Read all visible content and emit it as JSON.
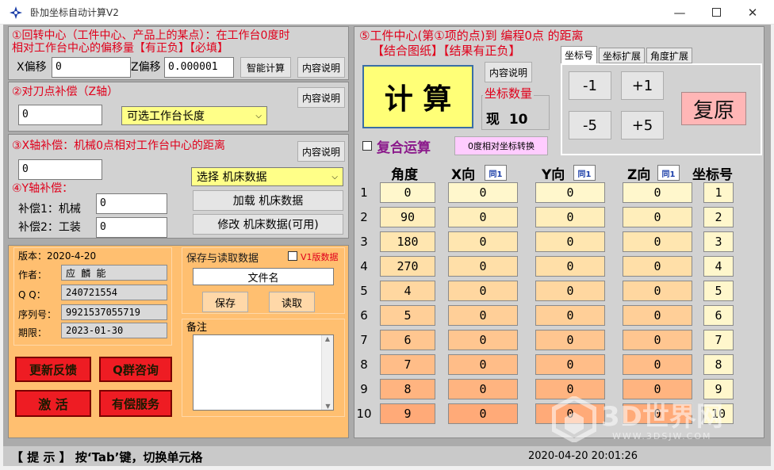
{
  "window": {
    "title": "卧加坐标自动计算V2"
  },
  "panel1": {
    "title_line1": "①回转中心（工件中心、产品上的某点）：在工作台0度时",
    "title_line2": "相对工作台中心的偏移量【有正负】【必填】",
    "x_label": "X偏移",
    "x_value": "0",
    "z_label": "Z偏移",
    "z_value": "0.000001",
    "smart_calc": "智能计算",
    "info": "内容说明"
  },
  "panel2": {
    "title": "②对刀点补偿（Z轴）",
    "value": "0",
    "combo": "可选工作台长度",
    "info": "内容说明"
  },
  "panel3": {
    "title": "③X轴补偿：机械0点相对工作台中心的距离",
    "value": "0",
    "info": "内容说明",
    "combo": "选择 机床数据",
    "y_title": "④Y轴补偿：",
    "comp1_label": "补偿1：机械",
    "comp1_value": "0",
    "comp2_label": "补偿2：工装",
    "comp2_value": "0",
    "load": "加载 机床数据",
    "modify": "修改 机床数据(可用)"
  },
  "info_panel": {
    "version": "版本：2020-4-20",
    "author_label": "作者：",
    "author": "应 麟 能",
    "qq_label": "Q Q：",
    "qq": "240721554",
    "serial_label": "序列号：",
    "serial": "9921537055719",
    "expiry_label": "期限：",
    "expiry": "2023-01-30",
    "update": "更新反馈",
    "qgroup": "Q群咨询",
    "activate": "激 活",
    "paid": "有偿服务",
    "save_title": "保存与读取数据",
    "v1_label": "V1版数据",
    "filename": "文件名",
    "save": "保存",
    "read": "读取",
    "remarks": "备注"
  },
  "panel5": {
    "title": "⑤工件中心(第①项的点)到 编程0点 的距离",
    "subtitle": "【结合图纸】【结果有正负】",
    "calc": "计 算",
    "info": "内容说明",
    "count_label": "坐标数量",
    "count_value": "现  10",
    "composite": "复合运算",
    "convert": "0度相对坐标转换",
    "tabs": [
      "坐标号",
      "坐标扩展",
      "角度扩展"
    ],
    "steps": [
      "-1",
      "+1",
      "-5",
      "+5"
    ],
    "reset": "复原",
    "headers": {
      "angle": "角度",
      "x": "X向",
      "y": "Y向",
      "z": "Z向",
      "coord": "坐标号",
      "tag": "同1"
    },
    "rows": [
      {
        "n": "1",
        "a": "0",
        "x": "0",
        "y": "0",
        "z": "0",
        "c": "1"
      },
      {
        "n": "2",
        "a": "90",
        "x": "0",
        "y": "0",
        "z": "0",
        "c": "2"
      },
      {
        "n": "3",
        "a": "180",
        "x": "0",
        "y": "0",
        "z": "0",
        "c": "3"
      },
      {
        "n": "4",
        "a": "270",
        "x": "0",
        "y": "0",
        "z": "0",
        "c": "4"
      },
      {
        "n": "5",
        "a": "4",
        "x": "0",
        "y": "0",
        "z": "0",
        "c": "5"
      },
      {
        "n": "6",
        "a": "5",
        "x": "0",
        "y": "0",
        "z": "0",
        "c": "6"
      },
      {
        "n": "7",
        "a": "6",
        "x": "0",
        "y": "0",
        "z": "0",
        "c": "7"
      },
      {
        "n": "8",
        "a": "7",
        "x": "0",
        "y": "0",
        "z": "0",
        "c": "8"
      },
      {
        "n": "9",
        "a": "8",
        "x": "0",
        "y": "0",
        "z": "0",
        "c": "9"
      },
      {
        "n": "10",
        "a": "9",
        "x": "0",
        "y": "0",
        "z": "0",
        "c": "10"
      }
    ],
    "row_colors": [
      "#fff7cc",
      "#ffeebb",
      "#ffe6b0",
      "#ffdfa8",
      "#ffd7a0",
      "#ffcf98",
      "#ffc690",
      "#ffbd88",
      "#ffb480",
      "#ffaa78"
    ]
  },
  "status": {
    "hint": "【 提 示 】 按‘Tab’键，切换单元格",
    "datetime": "2020-04-20 20:01:26"
  },
  "watermark": {
    "main": "3D世界网",
    "sub": "WWW.3DSJW.COM"
  }
}
